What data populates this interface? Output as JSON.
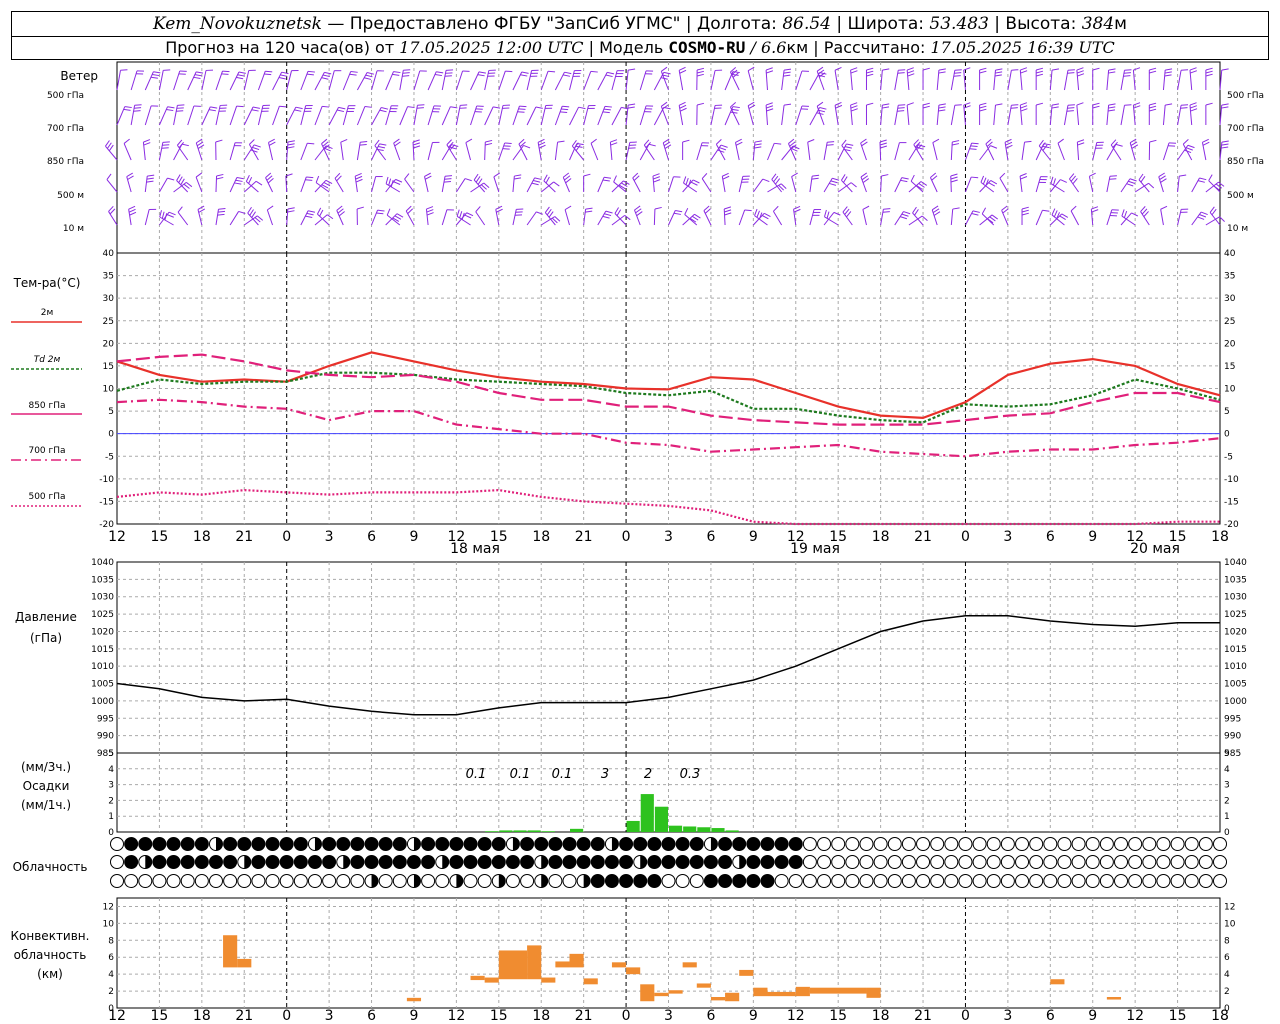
{
  "header": {
    "station": "Kem_Novokuznetsk",
    "provider": " — Предоставлено ФГБУ \"ЗапСиб УГМС\" | Долгота: ",
    "lon": "86.54",
    "lat_label": " | Широта: ",
    "lat": "53.483",
    "alt_label": " | Высота: ",
    "alt": "384",
    "alt_unit": "м",
    "fc_label": "Прогноз на 120 часа(ов) от ",
    "fc_time": "17.05.2025 12:00 UTC",
    "model_label": " | Модель ",
    "model": "COSMO-RU",
    "model_res": " / 6.6",
    "model_res_unit": "км",
    "calc_label": " | Рассчитано: ",
    "calc_time": "17.05.2025 16:39 UTC"
  },
  "time_axis": {
    "hour_labels": [
      "12",
      "15",
      "18",
      "21",
      "0",
      "3",
      "6",
      "9",
      "12",
      "15",
      "18",
      "21",
      "0",
      "3",
      "6",
      "9",
      "12",
      "15",
      "18",
      "21",
      "0",
      "3",
      "6",
      "9",
      "12",
      "15",
      "18"
    ],
    "day_labels": [
      "18 мая",
      "19 мая",
      "20 мая"
    ]
  },
  "panels": {
    "wind": {
      "title": "Ветер",
      "levels": [
        "500 гПа",
        "700 гПа",
        "850 гПа",
        "500 м",
        "10 м"
      ]
    },
    "temp": {
      "title": "Тем-ра(°C)",
      "legend": [
        "2м",
        "Td  2м",
        "850 гПа",
        "700 гПа",
        "500 гПа"
      ],
      "legend_colors": [
        "#e8312a",
        "#1e7a1e",
        "#e0207a",
        "#e0207a",
        "#e0207a"
      ]
    },
    "pressure": {
      "title": "Давление",
      "unit": "(гПа)"
    },
    "precip": {
      "unit3": "(мм/3ч.)",
      "title": "Осадки",
      "unit1": "(мм/1ч.)",
      "annotations": [
        "0.1",
        "0.1",
        "0.1",
        "3",
        "2",
        "0.3"
      ]
    },
    "cloud": {
      "title": "Облачность"
    },
    "conv": {
      "title": "Конвективн.",
      "title2": "облачность",
      "unit": "(км)"
    }
  },
  "colors": {
    "wind": "#8a2be2",
    "t2m": "#e8312a",
    "td": "#1e7a1e",
    "upper": "#e0207a",
    "zero": "#4040ff",
    "pressure": "#000000",
    "precip": "#2ec21e",
    "conv": "#f08c30"
  },
  "chart_data": [
    {
      "type": "line",
      "title": "Тем-ра(°C)",
      "x_hours": [
        0,
        3,
        6,
        9,
        12,
        15,
        18,
        21,
        24,
        27,
        30,
        33,
        36,
        39,
        42,
        45,
        48,
        51,
        54,
        57,
        60,
        63,
        66,
        69,
        72,
        75,
        78
      ],
      "ylim": [
        -20,
        40
      ],
      "series": [
        {
          "name": "2м",
          "values": [
            16,
            13,
            11.5,
            12,
            11.5,
            15,
            18,
            16,
            14,
            12.5,
            11.5,
            11,
            10,
            9.8,
            12.5,
            12,
            9,
            6,
            4,
            3.5,
            7,
            13,
            15.5,
            16.5,
            15,
            11,
            8.5
          ]
        },
        {
          "name": "Td  2м",
          "values": [
            9.5,
            12,
            11,
            11.5,
            11.5,
            13.5,
            13.5,
            13,
            12,
            11.5,
            11,
            10.5,
            9,
            8.5,
            9.5,
            5.5,
            5.5,
            4,
            3,
            2.5,
            6.5,
            6,
            6.5,
            8.5,
            12,
            10,
            7.5
          ]
        },
        {
          "name": "850 гПа",
          "values": [
            16,
            17,
            17.5,
            16,
            14,
            13,
            12.5,
            13,
            11.5,
            9,
            7.5,
            7.5,
            6,
            6,
            4,
            3,
            2.5,
            2,
            2,
            2,
            3,
            4,
            4.5,
            7,
            9,
            9,
            7
          ]
        },
        {
          "name": "700 гПа",
          "values": [
            7,
            7.5,
            7,
            6,
            5.5,
            3,
            5,
            5,
            2,
            1,
            0,
            0,
            -2,
            -2.5,
            -4,
            -3.5,
            -3,
            -2.5,
            -4,
            -4.5,
            -5,
            -4,
            -3.5,
            -3.5,
            -2.5,
            -2,
            -1
          ]
        },
        {
          "name": "500 гПа",
          "values": [
            -14,
            -13,
            -13.5,
            -12.5,
            -13,
            -13.5,
            -13,
            -13,
            -13,
            -12.5,
            -14,
            -15,
            -15.5,
            -16,
            -17,
            -19.5,
            -20.5,
            -21,
            -21,
            -21,
            -21,
            -21,
            -21,
            -21,
            -20,
            -19.5,
            -19.5
          ]
        }
      ]
    },
    {
      "type": "line",
      "title": "Давление",
      "x_hours": [
        0,
        3,
        6,
        9,
        12,
        15,
        18,
        21,
        24,
        27,
        30,
        33,
        36,
        39,
        42,
        45,
        48,
        51,
        54,
        57,
        60,
        63,
        66,
        69,
        72,
        75,
        78
      ],
      "ylim": [
        985,
        1040
      ],
      "series": [
        {
          "name": "Давление",
          "values": [
            1005,
            1003.5,
            1001,
            1000,
            1000.5,
            998.5,
            997,
            996,
            996,
            998,
            999.5,
            999.5,
            999.5,
            1001,
            1003.5,
            1006,
            1010,
            1015,
            1020,
            1023,
            1024.5,
            1024.5,
            1023,
            1022,
            1021.5,
            1022.5,
            1022.5
          ]
        }
      ]
    },
    {
      "type": "bar",
      "title": "Осадки",
      "ylim": [
        0,
        5
      ],
      "x_hours": [
        26,
        27,
        28,
        29,
        30,
        31,
        32,
        33,
        34,
        35,
        36,
        37,
        38,
        39,
        40,
        41,
        42,
        43
      ],
      "values": [
        0.05,
        0.1,
        0.1,
        0.1,
        0.05,
        0,
        0.2,
        0,
        0,
        0,
        0.7,
        2.4,
        1.6,
        0.4,
        0.35,
        0.3,
        0.25,
        0.1
      ]
    },
    {
      "type": "bar",
      "title": "Конвективн. облачность",
      "ylim": [
        0,
        13
      ],
      "bars": [
        {
          "x": [
            7.5,
            8.5
          ],
          "bottom": 4.8,
          "top": 8.6
        },
        {
          "x": [
            8.5,
            9.5
          ],
          "bottom": 4.8,
          "top": 5.8
        },
        {
          "x": [
            20.5,
            21.5
          ],
          "bottom": 0.8,
          "top": 1.2
        },
        {
          "x": [
            25,
            26
          ],
          "bottom": 3.3,
          "top": 3.8
        },
        {
          "x": [
            26,
            27
          ],
          "bottom": 3.0,
          "top": 3.6
        },
        {
          "x": [
            27,
            29
          ],
          "bottom": 3.4,
          "top": 6.8
        },
        {
          "x": [
            29,
            30
          ],
          "bottom": 3.4,
          "top": 7.4
        },
        {
          "x": [
            30,
            31
          ],
          "bottom": 3.0,
          "top": 3.6
        },
        {
          "x": [
            31,
            32
          ],
          "bottom": 4.8,
          "top": 5.5
        },
        {
          "x": [
            32,
            33
          ],
          "bottom": 4.8,
          "top": 6.4
        },
        {
          "x": [
            33,
            34
          ],
          "bottom": 2.8,
          "top": 3.5
        },
        {
          "x": [
            35,
            36
          ],
          "bottom": 4.8,
          "top": 5.4
        },
        {
          "x": [
            36,
            37
          ],
          "bottom": 4.0,
          "top": 4.8
        },
        {
          "x": [
            37,
            38
          ],
          "bottom": 0.8,
          "top": 2.8
        },
        {
          "x": [
            38,
            39
          ],
          "bottom": 1.4,
          "top": 1.8
        },
        {
          "x": [
            39,
            40
          ],
          "bottom": 1.7,
          "top": 2.1
        },
        {
          "x": [
            40,
            41
          ],
          "bottom": 4.8,
          "top": 5.4
        },
        {
          "x": [
            41,
            42
          ],
          "bottom": 2.4,
          "top": 2.9
        },
        {
          "x": [
            42,
            43
          ],
          "bottom": 0.9,
          "top": 1.3
        },
        {
          "x": [
            43,
            44
          ],
          "bottom": 0.8,
          "top": 1.8
        },
        {
          "x": [
            44,
            45
          ],
          "bottom": 3.8,
          "top": 4.5
        },
        {
          "x": [
            45,
            46
          ],
          "bottom": 1.4,
          "top": 2.4
        },
        {
          "x": [
            46,
            48
          ],
          "bottom": 1.4,
          "top": 1.9
        },
        {
          "x": [
            48,
            49
          ],
          "bottom": 1.4,
          "top": 2.5
        },
        {
          "x": [
            49,
            53
          ],
          "bottom": 1.7,
          "top": 2.4
        },
        {
          "x": [
            53,
            54
          ],
          "bottom": 1.2,
          "top": 2.4
        },
        {
          "x": [
            66,
            67
          ],
          "bottom": 2.8,
          "top": 3.4
        },
        {
          "x": [
            70,
            71
          ],
          "bottom": 1.0,
          "top": 1.3
        }
      ]
    }
  ]
}
